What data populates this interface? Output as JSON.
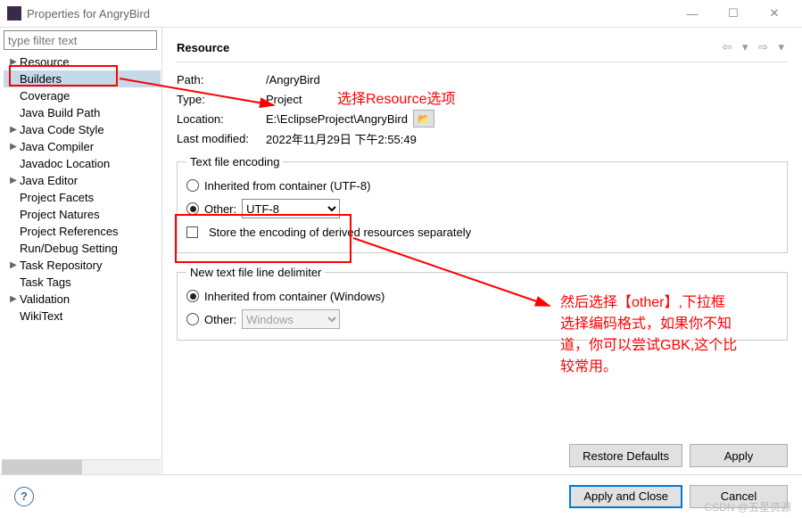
{
  "window": {
    "title": "Properties for AngryBird",
    "buttons": {
      "min": "—",
      "max": "☐",
      "close": "✕"
    }
  },
  "sidebar": {
    "filter_placeholder": "type filter text",
    "items": [
      {
        "label": "Resource",
        "expandable": true,
        "selected": false
      },
      {
        "label": "Builders",
        "expandable": false,
        "selected": true
      },
      {
        "label": "Coverage",
        "expandable": false
      },
      {
        "label": "Java Build Path",
        "expandable": false
      },
      {
        "label": "Java Code Style",
        "expandable": true
      },
      {
        "label": "Java Compiler",
        "expandable": true
      },
      {
        "label": "Javadoc Location",
        "expandable": false
      },
      {
        "label": "Java Editor",
        "expandable": true
      },
      {
        "label": "Project Facets",
        "expandable": false
      },
      {
        "label": "Project Natures",
        "expandable": false
      },
      {
        "label": "Project References",
        "expandable": false
      },
      {
        "label": "Run/Debug Setting",
        "expandable": false
      },
      {
        "label": "Task Repository",
        "expandable": true
      },
      {
        "label": "Task Tags",
        "expandable": false
      },
      {
        "label": "Validation",
        "expandable": true
      },
      {
        "label": "WikiText",
        "expandable": false
      }
    ]
  },
  "content": {
    "title": "Resource",
    "path_label": "Path:",
    "path_value": "/AngryBird",
    "type_label": "Type:",
    "type_value": "Project",
    "location_label": "Location:",
    "location_value": "E:\\EclipseProject\\AngryBird",
    "lastmod_label": "Last modified:",
    "lastmod_value": "2022年11月29日 下午2:55:49",
    "encoding_group": "Text file encoding",
    "encoding_inherit": "Inherited from container (UTF-8)",
    "encoding_other": "Other:",
    "encoding_other_value": "UTF-8",
    "encoding_store_derived": "Store the encoding of derived resources separately",
    "delim_group": "New text file line delimiter",
    "delim_inherit": "Inherited from container (Windows)",
    "delim_other": "Other:",
    "delim_other_value": "Windows",
    "restore_defaults": "Restore Defaults",
    "apply": "Apply"
  },
  "footer": {
    "apply_close": "Apply and Close",
    "cancel": "Cancel"
  },
  "annotations": {
    "text1": "选择Resource选项",
    "text2": "然后选择【other】,下拉框\n选择编码格式，如果你不知\n道，你可以尝试GBK,这个比\n较常用。"
  },
  "watermark": "CSDN @五星资源"
}
